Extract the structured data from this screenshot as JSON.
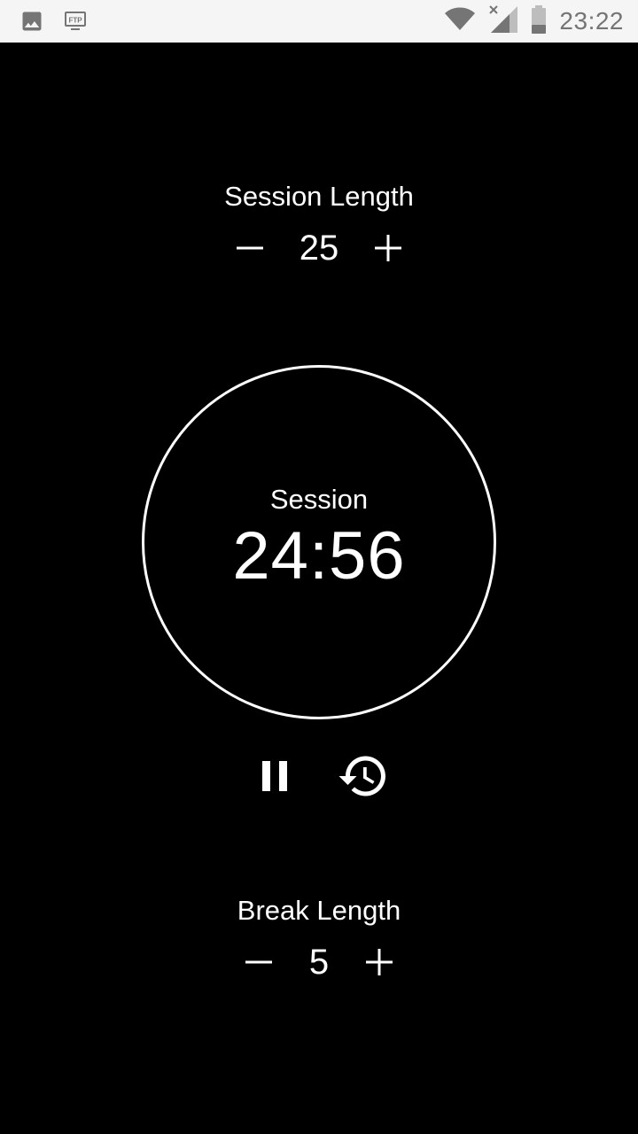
{
  "status_bar": {
    "time": "23:22",
    "left_icons": [
      "image-icon",
      "ftp-icon"
    ],
    "ftp_label": "FTP",
    "right_icons": [
      "wifi-icon",
      "cell-signal-icon",
      "battery-icon"
    ]
  },
  "session": {
    "title": "Session Length",
    "value": "25",
    "decrement_icon": "minus-icon",
    "increment_icon": "plus-icon"
  },
  "timer": {
    "label": "Session",
    "time": "24:56",
    "pause_icon": "pause-icon",
    "reset_icon": "restore-icon"
  },
  "break": {
    "title": "Break Length",
    "value": "5",
    "decrement_icon": "minus-icon",
    "increment_icon": "plus-icon"
  },
  "colors": {
    "background": "#000000",
    "foreground": "#ffffff",
    "status_bar_bg": "#f5f5f5",
    "status_icon": "#757575"
  }
}
